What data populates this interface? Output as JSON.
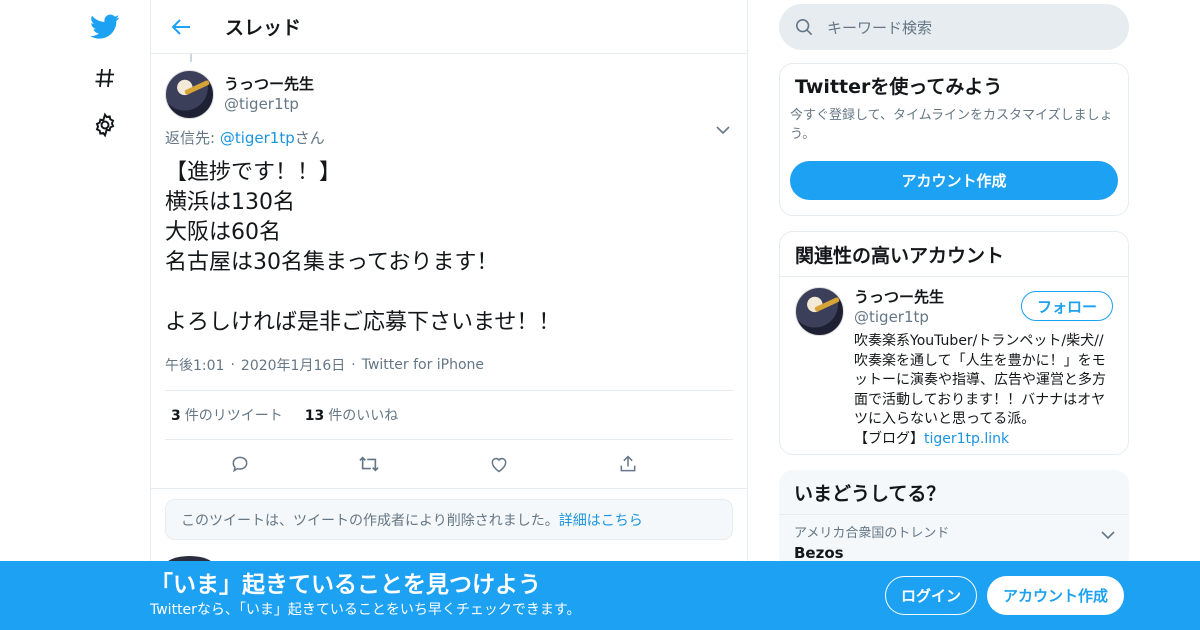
{
  "colors": {
    "accent": "#1da1f2",
    "link": "#1b95e0",
    "muted": "#657786",
    "border": "#e6ecf0"
  },
  "nav": {
    "icons": [
      "twitter-logo-icon",
      "hashtag-icon",
      "gear-icon"
    ]
  },
  "header": {
    "title": "スレッド"
  },
  "tweet": {
    "author_name": "うっつー先生",
    "author_handle": "@tiger1tp",
    "reply_prefix": "返信先: ",
    "reply_handle": "@tiger1tp",
    "reply_suffix": "さん",
    "body": "【進捗です！！】\n横浜は130名\n大阪は60名\n名古屋は30名集まっております！\n\nよろしければ是非ご応募下さいませ！！",
    "time": "午後1:01",
    "date": "2020年1月16日",
    "source": "Twitter for iPhone",
    "retweet_count": "3",
    "retweet_label": "件のリツイート",
    "like_count": "13",
    "like_label": "件のいいね"
  },
  "deleted_notice": {
    "text": "このツイートは、ツイートの作成者により削除されました。",
    "link": "詳細はこちら"
  },
  "search": {
    "placeholder": "キーワード検索"
  },
  "signup_card": {
    "title": "Twitterを使ってみよう",
    "desc": "今すぐ登録して、タイムラインをカスタマイズしましょう。",
    "button": "アカウント作成"
  },
  "related": {
    "title": "関連性の高いアカウント",
    "name": "うっつー先生",
    "handle": "@tiger1tp",
    "follow": "フォロー",
    "bio": "吹奏楽系YouTuber/トランペット/柴犬//吹奏楽を通して「人生を豊かに！」をモットーに演奏や指導、広告や運営と多方面で活動しております！！バナナはオヤツに入らないと思ってる派。\n【ブログ】",
    "bio_link": "tiger1tp.link"
  },
  "trends": {
    "title": "いまどうしてる？",
    "items": [
      {
        "context": "アメリカ合衆国のトレンド",
        "name": "Bezos"
      }
    ]
  },
  "banner": {
    "title": "「いま」起きていることを見つけよう",
    "subtitle": "Twitterなら、「いま」起きていることをいち早くチェックできます。",
    "login": "ログイン",
    "signup": "アカウント作成"
  }
}
